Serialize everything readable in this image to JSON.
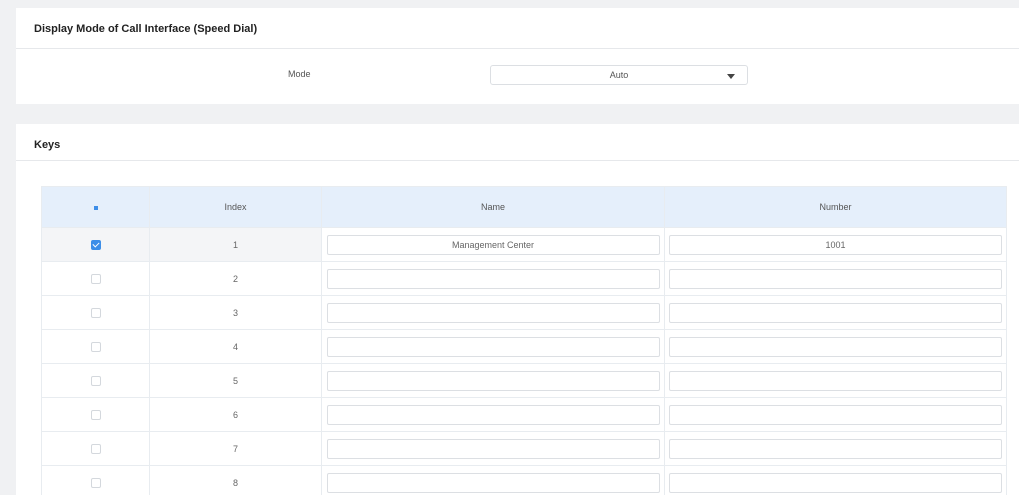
{
  "display_mode": {
    "title": "Display Mode of Call Interface (Speed Dial)",
    "mode_label": "Mode",
    "mode_value": "Auto"
  },
  "keys": {
    "title": "Keys",
    "columns": {
      "index": "Index",
      "name": "Name",
      "number": "Number"
    },
    "rows": [
      {
        "index": "1",
        "name": "Management Center",
        "number": "1001",
        "checked": true
      },
      {
        "index": "2",
        "name": "",
        "number": "",
        "checked": false
      },
      {
        "index": "3",
        "name": "",
        "number": "",
        "checked": false
      },
      {
        "index": "4",
        "name": "",
        "number": "",
        "checked": false
      },
      {
        "index": "5",
        "name": "",
        "number": "",
        "checked": false
      },
      {
        "index": "6",
        "name": "",
        "number": "",
        "checked": false
      },
      {
        "index": "7",
        "name": "",
        "number": "",
        "checked": false
      },
      {
        "index": "8",
        "name": "",
        "number": "",
        "checked": false
      }
    ]
  },
  "colors": {
    "accent": "#3d8ee8",
    "table_header_bg": "#e5effb",
    "page_bg": "#f0f1f3"
  }
}
